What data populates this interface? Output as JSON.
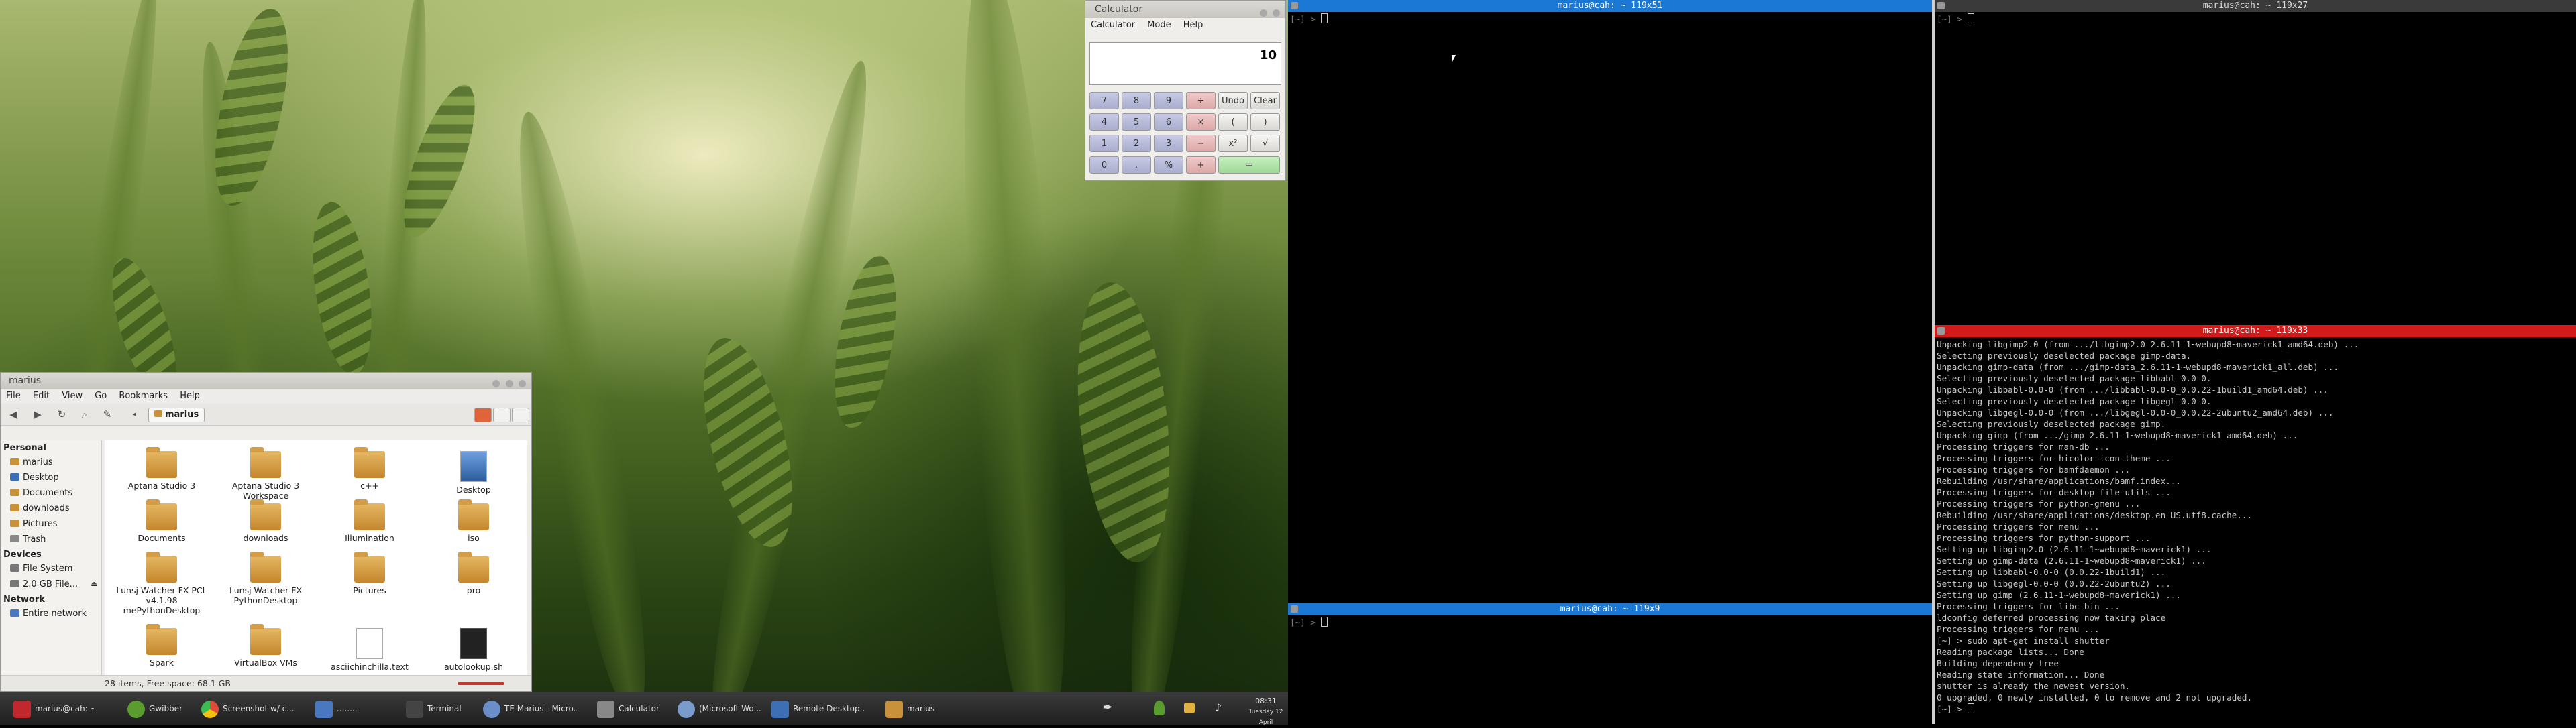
{
  "file_manager": {
    "title": "marius",
    "menu": [
      "File",
      "Edit",
      "View",
      "Go",
      "Bookmarks",
      "Help"
    ],
    "location": "marius",
    "sidebar": {
      "personal_label": "Personal",
      "personal": [
        "marius",
        "Desktop",
        "Documents",
        "downloads",
        "Pictures",
        "Trash"
      ],
      "devices_label": "Devices",
      "devices": [
        "File System",
        "2.0 GB File..."
      ],
      "network_label": "Network",
      "network": [
        "Entire network"
      ]
    },
    "files": [
      {
        "name": "Aptana Studio 3",
        "type": "folder"
      },
      {
        "name": "Aptana Studio 3 Workspace",
        "type": "folder"
      },
      {
        "name": "c++",
        "type": "folder"
      },
      {
        "name": "Desktop",
        "type": "desktop"
      },
      {
        "name": "Documents",
        "type": "folder"
      },
      {
        "name": "downloads",
        "type": "folder"
      },
      {
        "name": "Illumination",
        "type": "folder"
      },
      {
        "name": "iso",
        "type": "folder"
      },
      {
        "name": "Lunsj Watcher FX PCL v4.1.98 mePythonDesktop",
        "type": "folder"
      },
      {
        "name": "Lunsj Watcher FX PythonDesktop",
        "type": "folder"
      },
      {
        "name": "Pictures",
        "type": "folder"
      },
      {
        "name": "pro",
        "type": "folder"
      },
      {
        "name": "Spark",
        "type": "folder"
      },
      {
        "name": "VirtualBox VMs",
        "type": "folder"
      },
      {
        "name": "asciichinchilla.text",
        "type": "text"
      },
      {
        "name": "autolookup.sh",
        "type": "script"
      }
    ],
    "status": "28 items, Free space: 68.1 GB"
  },
  "calculator": {
    "title": "Calculator",
    "menu": [
      "Calculator",
      "Mode",
      "Help"
    ],
    "display": "10",
    "keys": [
      [
        "7",
        "8",
        "9",
        "÷",
        "Undo",
        "Clear"
      ],
      [
        "4",
        "5",
        "6",
        "×",
        "(",
        ")"
      ],
      [
        "1",
        "2",
        "3",
        "−",
        "x²",
        "√"
      ],
      [
        "0",
        ".",
        "%",
        "+",
        "="
      ]
    ]
  },
  "terminals": {
    "t1": {
      "title": "marius@cah: ~ 119x51",
      "prompt": "[~] >"
    },
    "t2": {
      "title": "marius@cah: ~ 119x27",
      "prompt": "[~] >"
    },
    "t3": {
      "title": "marius@cah: ~ 119x9",
      "prompt": "[~] >"
    },
    "t4": {
      "title": "marius@cah: ~ 119x33",
      "lines": [
        "Unpacking libgimp2.0 (from .../libgimp2.0_2.6.11-1~webupd8~maverick1_amd64.deb) ...",
        "Selecting previously deselected package gimp-data.",
        "Unpacking gimp-data (from .../gimp-data_2.6.11-1~webupd8~maverick1_all.deb) ...",
        "Selecting previously deselected package libbabl-0.0-0.",
        "Unpacking libbabl-0.0-0 (from .../libbabl-0.0-0_0.0.22-1build1_amd64.deb) ...",
        "Selecting previously deselected package libgegl-0.0-0.",
        "Unpacking libgegl-0.0-0 (from .../libgegl-0.0-0_0.0.22-2ubuntu2_amd64.deb) ...",
        "Selecting previously deselected package gimp.",
        "Unpacking gimp (from .../gimp_2.6.11-1~webupd8~maverick1_amd64.deb) ...",
        "Processing triggers for man-db ...",
        "Processing triggers for hicolor-icon-theme ...",
        "Processing triggers for bamfdaemon ...",
        "Rebuilding /usr/share/applications/bamf.index...",
        "Processing triggers for desktop-file-utils ...",
        "Processing triggers for python-gmenu ...",
        "Rebuilding /usr/share/applications/desktop.en_US.utf8.cache...",
        "Processing triggers for menu ...",
        "Processing triggers for python-support ...",
        "Setting up libgimp2.0 (2.6.11-1~webupd8~maverick1) ...",
        "Setting up gimp-data (2.6.11-1~webupd8~maverick1) ...",
        "Setting up libbabl-0.0-0 (0.0.22-1build1) ...",
        "Setting up libgegl-0.0-0 (0.0.22-2ubuntu2) ...",
        "Setting up gimp (2.6.11-1~webupd8~maverick1) ...",
        "Processing triggers for libc-bin ...",
        "ldconfig deferred processing now taking place",
        "Processing triggers for menu ...",
        "[~] > sudo apt-get install shutter",
        "Reading package lists... Done",
        "Building dependency tree",
        "Reading state information... Done",
        "shutter is already the newest version.",
        "0 upgraded, 0 newly installed, 0 to remove and 2 not upgraded.",
        "[~] >"
      ]
    }
  },
  "taskbar": {
    "tasks": [
      {
        "label": "marius@cah: ~",
        "color": "#c0282d"
      },
      {
        "label": "Gwibber",
        "color": "#5a9c2e"
      },
      {
        "label": "Screenshot w/ c...",
        "color": "#dd4b39"
      },
      {
        "label": "........",
        "color": "#4a78c0"
      },
      {
        "label": "Terminal",
        "color": "#444444"
      },
      {
        "label": "TE Marius - Micro...",
        "color": "#6a8fc8"
      },
      {
        "label": "Calculator",
        "color": "#888888"
      },
      {
        "label": "(Microsoft Wo...",
        "color": "#7a9ccc"
      },
      {
        "label": "Remote Desktop ...",
        "color": "#3d6fb5"
      },
      {
        "label": "marius",
        "color": "#c9923a"
      }
    ],
    "clock_time": "08:31",
    "clock_date": "Tuesday 12 April"
  }
}
